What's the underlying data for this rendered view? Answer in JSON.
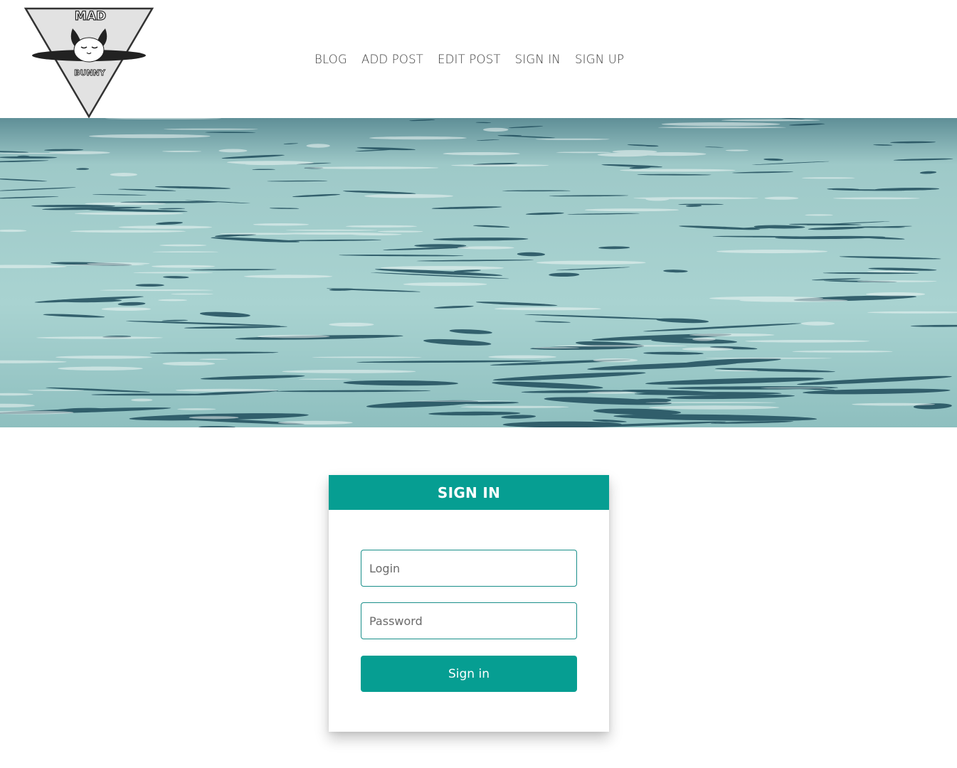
{
  "logo": {
    "top_text": "MAD",
    "bottom_text": "BUNNY",
    "icon": "bunny-triangle-logo"
  },
  "nav": {
    "items": [
      {
        "label": "BLOG"
      },
      {
        "label": "ADD POST"
      },
      {
        "label": "EDIT POST"
      },
      {
        "label": "SIGN IN"
      },
      {
        "label": "SIGN UP"
      }
    ]
  },
  "hero": {
    "image": "water-surface-photo"
  },
  "signin": {
    "title": "SIGN IN",
    "login_placeholder": "Login",
    "password_placeholder": "Password",
    "button_label": "Sign in"
  },
  "colors": {
    "accent": "#069e92",
    "input_border": "#1a8f8a",
    "nav_text": "#3b3b3b"
  }
}
